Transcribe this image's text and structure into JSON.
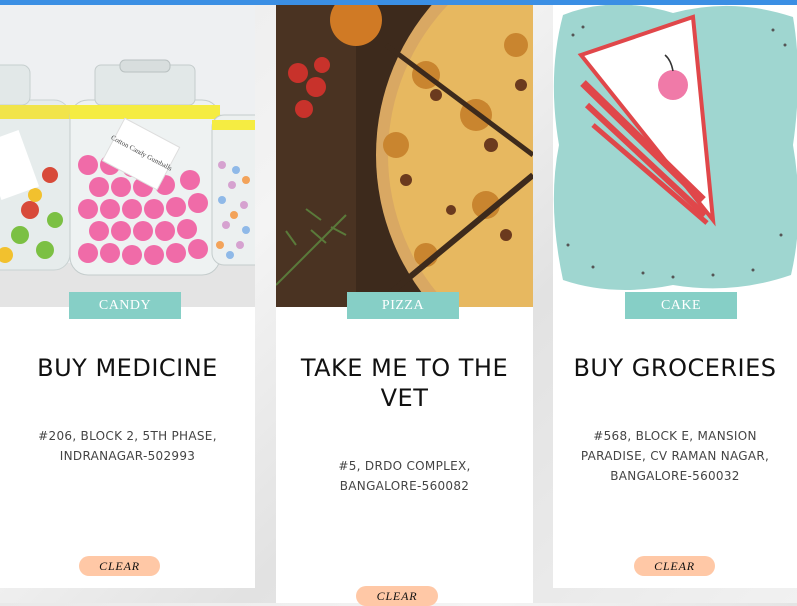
{
  "colors": {
    "accent_bar": "#3b8fe4",
    "tag_bg": "#86cfc6",
    "clear_bg": "#ffc8a6"
  },
  "cards": [
    {
      "image_icon": "candy-jars-image",
      "category": "CANDY",
      "title_lines": [
        "BUY MEDICINE"
      ],
      "address_lines": [
        "#206, BLOCK 2, 5TH PHASE,",
        "INDRANAGAR-502993"
      ],
      "button": "CLEAR",
      "jar_label": "Cotton Candy Gumballs"
    },
    {
      "image_icon": "pizza-image",
      "category": "PIZZA",
      "title_lines": [
        "TAKE ME TO THE",
        "VET"
      ],
      "address_lines": [
        "#5, DRDO COMPLEX,",
        "BANGALORE-560082"
      ],
      "button": "CLEAR"
    },
    {
      "image_icon": "cake-slice-image",
      "category": "CAKE",
      "title_lines": [
        "BUY GROCERIES"
      ],
      "address_lines": [
        "#568, BLOCK E, MANSION",
        "PARADISE, CV RAMAN NAGAR,",
        "BANGALORE-560032"
      ],
      "button": "CLEAR"
    }
  ]
}
